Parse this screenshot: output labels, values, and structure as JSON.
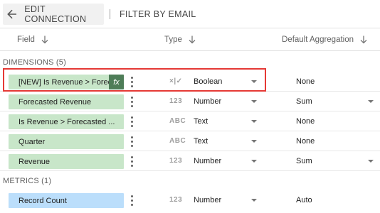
{
  "toolbar": {
    "back_label": "EDIT CONNECTION",
    "filter_label": "FILTER BY EMAIL"
  },
  "columns": {
    "field": "Field",
    "type": "Type",
    "aggregation": "Default Aggregation"
  },
  "dimensions": {
    "label": "DIMENSIONS (5)",
    "rows": [
      {
        "name": "[NEW] Is Revenue > Forec...",
        "calculated": true,
        "fx": "fx",
        "type_icon": "×|✓",
        "type": "Boolean",
        "aggregation": "None",
        "agg_dropdown": false
      },
      {
        "name": "Forecasted Revenue",
        "type_icon": "123",
        "type": "Number",
        "aggregation": "Sum",
        "agg_dropdown": true
      },
      {
        "name": "Is Revenue > Forecasted ...",
        "type_icon": "ABC",
        "type": "Text",
        "aggregation": "None",
        "agg_dropdown": false
      },
      {
        "name": "Quarter",
        "type_icon": "ABC",
        "type": "Text",
        "aggregation": "None",
        "agg_dropdown": false
      },
      {
        "name": "Revenue",
        "type_icon": "123",
        "type": "Number",
        "aggregation": "Sum",
        "agg_dropdown": true
      }
    ]
  },
  "metrics": {
    "label": "METRICS (1)",
    "rows": [
      {
        "name": "Record Count",
        "type_icon": "123",
        "type": "Number",
        "aggregation": "Auto",
        "agg_dropdown": false
      }
    ]
  },
  "colors": {
    "dimension_chip": "#c8e6c9",
    "metric_chip": "#bbdefb",
    "fx_badge": "#4e7d58",
    "highlight": "#e53935"
  }
}
